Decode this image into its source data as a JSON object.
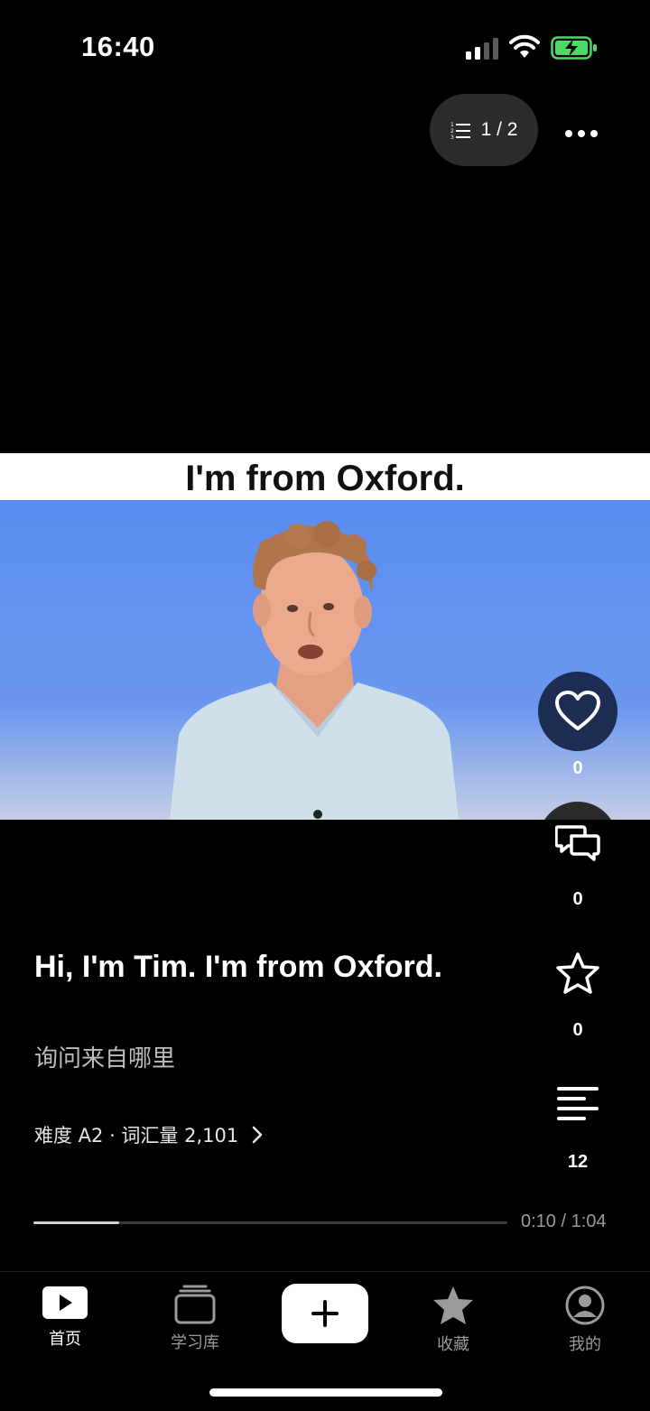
{
  "status_bar": {
    "time": "16:40"
  },
  "top": {
    "playlist_counter": "1 / 2"
  },
  "video": {
    "caption": "I'm from Oxford."
  },
  "actions": {
    "like_count": "0",
    "comment_count": "0",
    "favorite_count": "0",
    "transcript_count": "12"
  },
  "content": {
    "title": "Hi, I'm Tim. I'm from Oxford.",
    "subtitle": "询问来自哪里",
    "meta": "难度 A2 · 词汇量 2,101"
  },
  "playback": {
    "time": "0:10 / 1:04",
    "progress": 0.18
  },
  "tabbar": {
    "items": [
      {
        "label": "首页",
        "icon": "play-icon",
        "active": true
      },
      {
        "label": "学习库",
        "icon": "library-icon",
        "active": false
      },
      {
        "label": "收藏",
        "icon": "star-icon",
        "active": false
      },
      {
        "label": "我的",
        "icon": "profile-icon",
        "active": false
      }
    ],
    "add_icon": "plus-icon"
  },
  "colors": {
    "like_bg": "#1d2c52",
    "video_bg": "#5a8df2",
    "battery": "#4cd964"
  }
}
